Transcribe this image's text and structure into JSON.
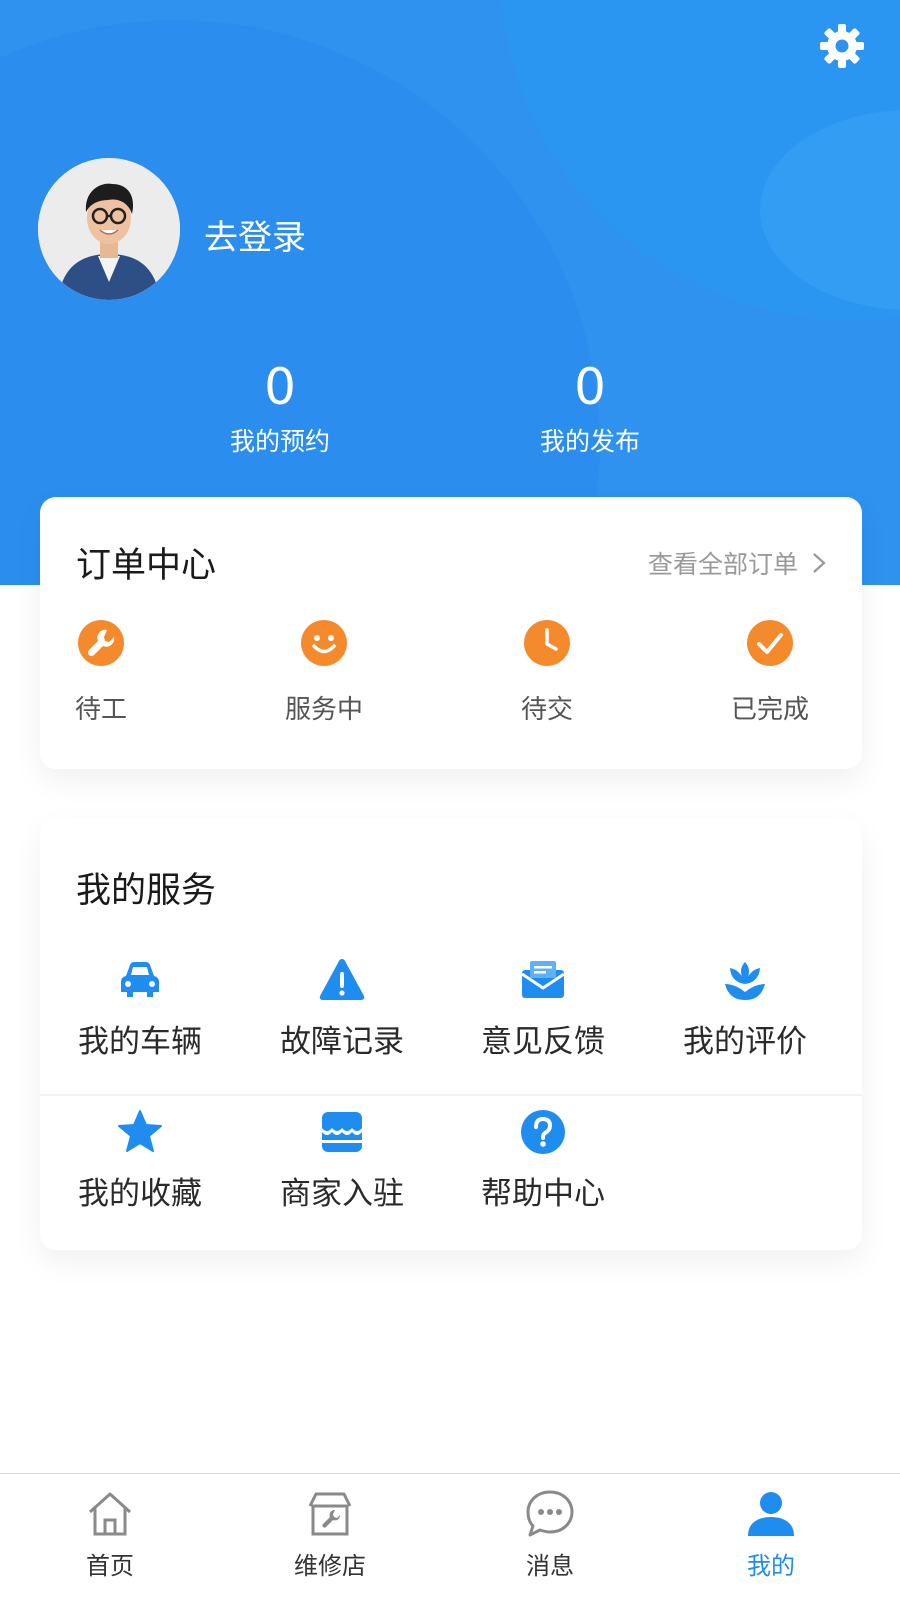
{
  "header": {
    "login_text": "去登录",
    "stats": [
      {
        "value": "0",
        "label": "我的预约"
      },
      {
        "value": "0",
        "label": "我的发布"
      }
    ]
  },
  "orders": {
    "title": "订单中心",
    "view_all": "查看全部订单",
    "items": [
      {
        "label": "待工",
        "icon": "wrench-icon"
      },
      {
        "label": "服务中",
        "icon": "smile-icon"
      },
      {
        "label": "待交",
        "icon": "clock-icon"
      },
      {
        "label": "已完成",
        "icon": "check-icon"
      }
    ]
  },
  "services": {
    "title": "我的服务",
    "items": [
      {
        "label": "我的车辆",
        "icon": "car-icon"
      },
      {
        "label": "故障记录",
        "icon": "warning-icon"
      },
      {
        "label": "意见反馈",
        "icon": "mail-icon"
      },
      {
        "label": "我的评价",
        "icon": "flower-icon"
      },
      {
        "label": "我的收藏",
        "icon": "star-icon"
      },
      {
        "label": "商家入驻",
        "icon": "shop-icon"
      },
      {
        "label": "帮助中心",
        "icon": "help-icon"
      }
    ]
  },
  "tabbar": {
    "tabs": [
      {
        "label": "首页",
        "icon": "home-icon"
      },
      {
        "label": "维修店",
        "icon": "repair-shop-icon"
      },
      {
        "label": "消息",
        "icon": "message-icon"
      },
      {
        "label": "我的",
        "icon": "user-icon",
        "active": true
      }
    ]
  },
  "colors": {
    "header_blue": "#2f92ef",
    "accent_orange": "#f58a2c",
    "accent_blue": "#1f8cf0"
  }
}
